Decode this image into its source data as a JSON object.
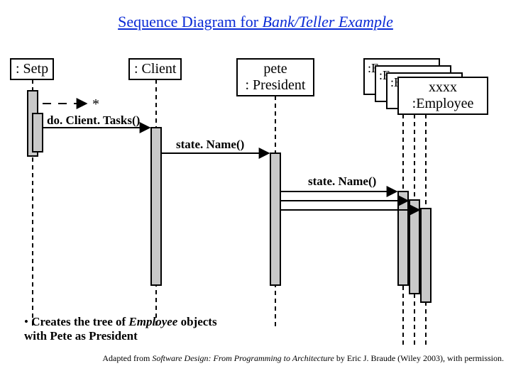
{
  "title_prefix": "Sequence Diagram for ",
  "title_italic": "Bank/Teller Example",
  "participants": {
    "setp": ": Setp",
    "client": ": Client",
    "pete_line1": "pete",
    "pete_line2": ": President",
    "emp_top": "xxxx",
    "emp_bottom": "Employee",
    "stack_e": "E"
  },
  "messages": {
    "loop": "*",
    "m1": "do. Client. Tasks()",
    "m2": "state. Name()",
    "m3": "state. Name()"
  },
  "note": {
    "bullet": "•",
    "text_a": " Creates the tree of ",
    "text_b": "Employee",
    "text_c": " objects",
    "text_d": "with Pete as President"
  },
  "attribution": {
    "a": "Adapted from ",
    "b": "Software Design: From Programming to Architecture",
    "c": " by Eric J. Braude (Wiley 2003), with permission."
  }
}
